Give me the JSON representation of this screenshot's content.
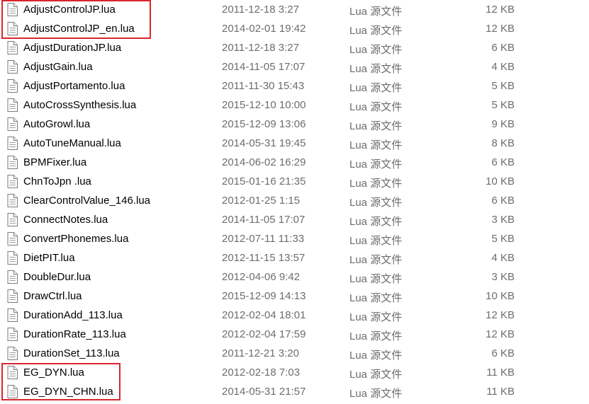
{
  "files": [
    {
      "name": "AdjustControlJP.lua",
      "date": "2011-12-18 3:27",
      "type": "Lua 源文件",
      "size": "12 KB"
    },
    {
      "name": "AdjustControlJP_en.lua",
      "date": "2014-02-01 19:42",
      "type": "Lua 源文件",
      "size": "12 KB"
    },
    {
      "name": "AdjustDurationJP.lua",
      "date": "2011-12-18 3:27",
      "type": "Lua 源文件",
      "size": "6 KB"
    },
    {
      "name": "AdjustGain.lua",
      "date": "2014-11-05 17:07",
      "type": "Lua 源文件",
      "size": "4 KB"
    },
    {
      "name": "AdjustPortamento.lua",
      "date": "2011-11-30 15:43",
      "type": "Lua 源文件",
      "size": "5 KB"
    },
    {
      "name": "AutoCrossSynthesis.lua",
      "date": "2015-12-10 10:00",
      "type": "Lua 源文件",
      "size": "5 KB"
    },
    {
      "name": "AutoGrowl.lua",
      "date": "2015-12-09 13:06",
      "type": "Lua 源文件",
      "size": "9 KB"
    },
    {
      "name": "AutoTuneManual.lua",
      "date": "2014-05-31 19:45",
      "type": "Lua 源文件",
      "size": "8 KB"
    },
    {
      "name": "BPMFixer.lua",
      "date": "2014-06-02 16:29",
      "type": "Lua 源文件",
      "size": "6 KB"
    },
    {
      "name": "ChnToJpn .lua",
      "date": "2015-01-16 21:35",
      "type": "Lua 源文件",
      "size": "10 KB"
    },
    {
      "name": "ClearControlValue_146.lua",
      "date": "2012-01-25 1:15",
      "type": "Lua 源文件",
      "size": "6 KB"
    },
    {
      "name": "ConnectNotes.lua",
      "date": "2014-11-05 17:07",
      "type": "Lua 源文件",
      "size": "3 KB"
    },
    {
      "name": "ConvertPhonemes.lua",
      "date": "2012-07-11 11:33",
      "type": "Lua 源文件",
      "size": "5 KB"
    },
    {
      "name": "DietPIT.lua",
      "date": "2012-11-15 13:57",
      "type": "Lua 源文件",
      "size": "4 KB"
    },
    {
      "name": "DoubleDur.lua",
      "date": "2012-04-06 9:42",
      "type": "Lua 源文件",
      "size": "3 KB"
    },
    {
      "name": "DrawCtrl.lua",
      "date": "2015-12-09 14:13",
      "type": "Lua 源文件",
      "size": "10 KB"
    },
    {
      "name": "DurationAdd_113.lua",
      "date": "2012-02-04 18:01",
      "type": "Lua 源文件",
      "size": "12 KB"
    },
    {
      "name": "DurationRate_113.lua",
      "date": "2012-02-04 17:59",
      "type": "Lua 源文件",
      "size": "12 KB"
    },
    {
      "name": "DurationSet_113.lua",
      "date": "2011-12-21 3:20",
      "type": "Lua 源文件",
      "size": "6 KB"
    },
    {
      "name": "EG_DYN.lua",
      "date": "2012-02-18 7:03",
      "type": "Lua 源文件",
      "size": "11 KB"
    },
    {
      "name": "EG_DYN_CHN.lua",
      "date": "2014-05-31 21:57",
      "type": "Lua 源文件",
      "size": "11 KB"
    }
  ],
  "icons": {
    "file": "document-icon"
  },
  "colors": {
    "highlight": "#d9262c",
    "secondary_text": "#6d6d6d"
  }
}
